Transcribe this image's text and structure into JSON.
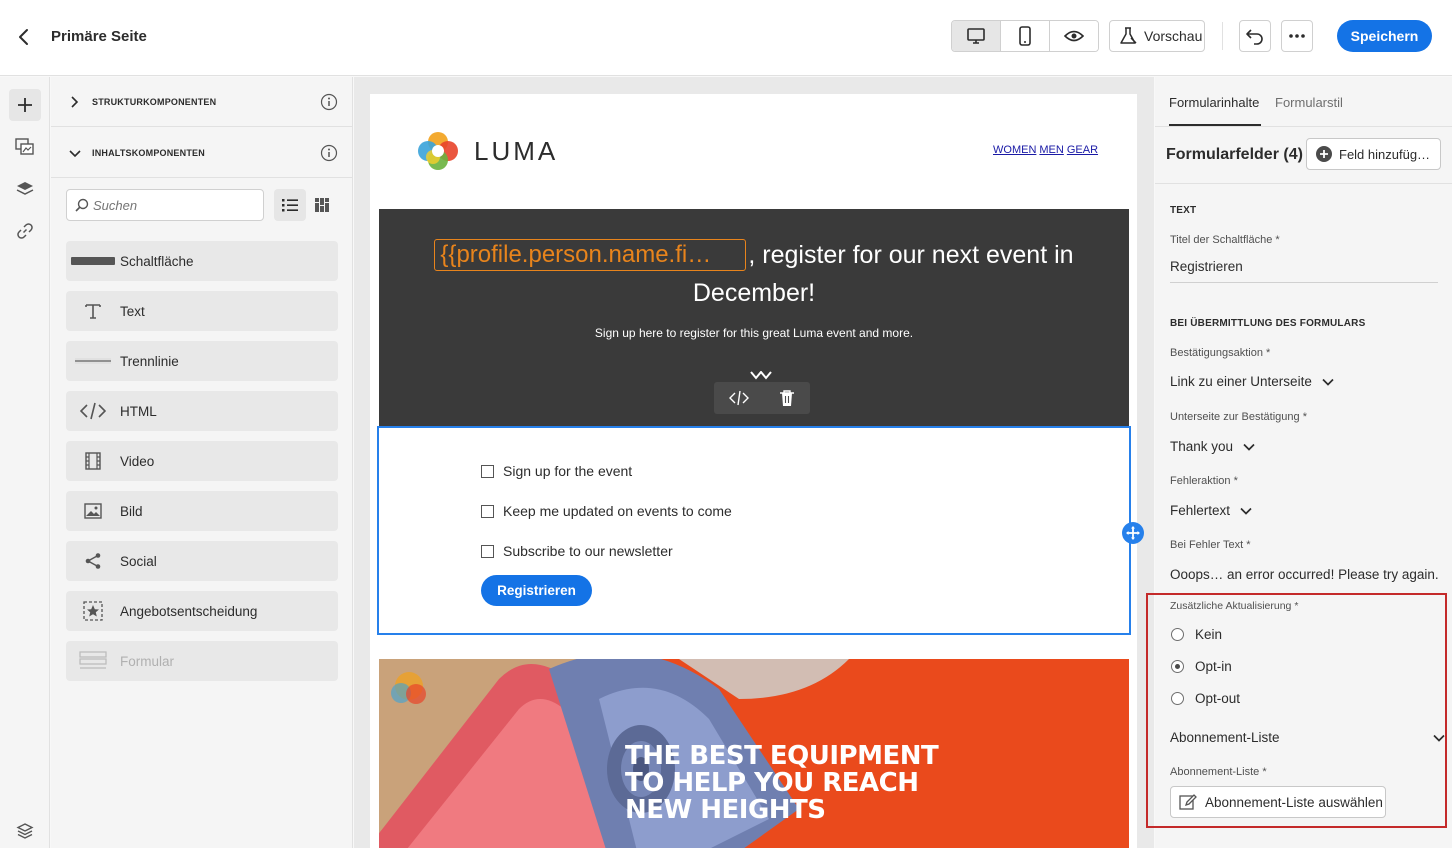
{
  "header": {
    "title": "Primäre Seite",
    "preview_label": "Vorschau",
    "save_label": "Speichern"
  },
  "components": {
    "structure_label": "STRUKTURKOMPONENTEN",
    "content_label": "INHALTSKOMPONENTEN",
    "search_placeholder": "Suchen",
    "items": [
      {
        "label": "Schaltfläche",
        "icon": "button-icon"
      },
      {
        "label": "Text",
        "icon": "text-icon"
      },
      {
        "label": "Trennlinie",
        "icon": "divider-icon"
      },
      {
        "label": "HTML",
        "icon": "code-icon"
      },
      {
        "label": "Video",
        "icon": "video-icon"
      },
      {
        "label": "Bild",
        "icon": "image-icon"
      },
      {
        "label": "Social",
        "icon": "share-icon"
      },
      {
        "label": "Angebotsentscheidung",
        "icon": "offer-icon"
      },
      {
        "label": "Formular",
        "icon": "form-icon",
        "disabled": true
      }
    ]
  },
  "email": {
    "logo_text": "LUMA",
    "nav": [
      "WOMEN",
      "MEN",
      "GEAR"
    ],
    "token": "{{profile.person.name.fi…",
    "hero_line1_rest": ", register for our next event in",
    "hero_line2": "December!",
    "hero_sub": "Sign up here to register for this great Luma event and more.",
    "checkboxes": [
      "Sign up for the event",
      "Keep me updated on events to come",
      "Subscribe to our newsletter"
    ],
    "register_label": "Registrieren",
    "promo_lines": [
      "THE BEST EQUIPMENT",
      "TO HELP YOU REACH",
      "NEW HEIGHTS"
    ]
  },
  "props": {
    "tab_content": "Formularinhalte",
    "tab_style": "Formularstil",
    "fields_title": "Formularfelder (4)",
    "add_field_label": "Feld hinzufüg…",
    "text_section": "TEXT",
    "button_title_label": "Titel der Schaltfläche",
    "button_title_value": "Registrieren",
    "submit_section": "BEI ÜBERMITTLUNG DES FORMULARS",
    "confirm_action_label": "Bestätigungsaktion",
    "confirm_action_value": "Link zu einer Unterseite",
    "confirm_page_label": "Unterseite zur Bestätigung",
    "confirm_page_value": "Thank you",
    "error_action_label": "Fehleraktion",
    "error_action_value": "Fehlertext",
    "error_text_label": "Bei Fehler Text",
    "error_text_value": "Ooops… an error occurred! Please try again.",
    "additional_update_label": "Zusätzliche Aktualisierung",
    "radio_options": [
      {
        "label": "Kein",
        "selected": false
      },
      {
        "label": "Opt-in",
        "selected": true
      },
      {
        "label": "Opt-out",
        "selected": false
      }
    ],
    "subscription_heading": "Abonnement-Liste",
    "subscription_label": "Abonnement-Liste",
    "subscription_button": "Abonnement-Liste auswählen",
    "required_marker": "*"
  },
  "colors": {
    "accent": "#1473e6",
    "selection": "#2680eb",
    "highlight": "#c42a2a",
    "token": "#e8841c",
    "hero_bg": "#3a3a3a",
    "promo_bg": "#ea4a1c"
  }
}
